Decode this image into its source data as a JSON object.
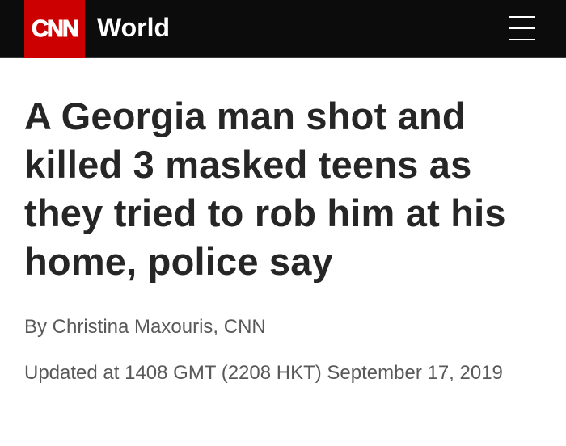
{
  "header": {
    "logo_text": "CNN",
    "section": "World",
    "menu_icon": "hamburger-menu-icon",
    "colors": {
      "bar_background": "#0c0c0c",
      "logo_background": "#cc0000"
    }
  },
  "article": {
    "headline": "A Georgia man shot and killed 3 masked teens as they tried to rob him at his home, police say",
    "byline": "By Christina Maxouris, CNN",
    "updated": "Updated at 1408 GMT (2208 HKT) September 17, 2019"
  }
}
